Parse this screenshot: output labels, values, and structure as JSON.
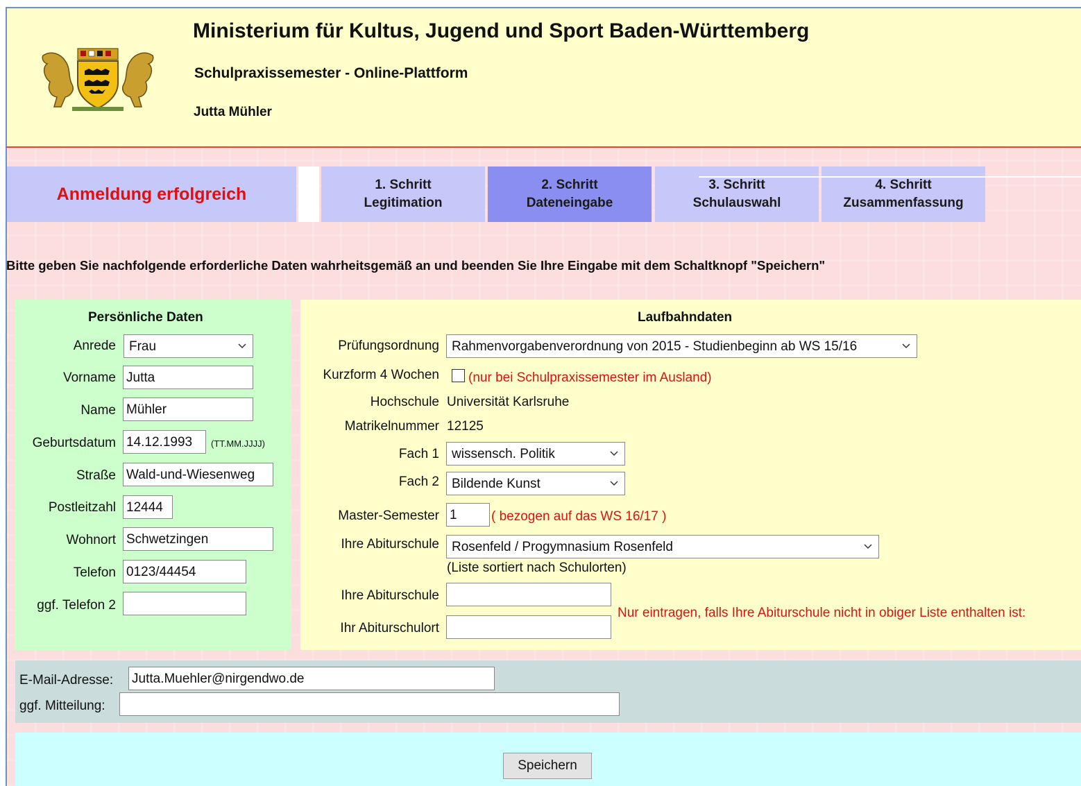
{
  "header": {
    "title": "Ministerium für Kultus, Jugend und Sport Baden-Württemberg",
    "subtitle": "Schulpraxissemester - Online-Plattform",
    "user": "Jutta Mühler"
  },
  "tabs": {
    "status": "Anmeldung erfolgreich",
    "steps": [
      {
        "line1": "1. Schritt",
        "line2": "Legitimation"
      },
      {
        "line1": "2. Schritt",
        "line2": "Dateneingabe"
      },
      {
        "line1": "3. Schritt",
        "line2": "Schulauswahl"
      },
      {
        "line1": "4. Schritt",
        "line2": "Zusammenfassung"
      }
    ],
    "active_step": 2
  },
  "instruction": "Bitte geben Sie nachfolgende erforderliche Daten wahrheitsgemäß an und beenden Sie Ihre Eingabe mit dem Schaltknopf \"Speichern\"",
  "personal": {
    "title": "Persönliche Daten",
    "anrede_label": "Anrede",
    "anrede_value": "Frau",
    "vorname_label": "Vorname",
    "vorname_value": "Jutta",
    "name_label": "Name",
    "name_value": "Mühler",
    "geburtsdatum_label": "Geburtsdatum",
    "geburtsdatum_value": "14.12.1993",
    "geburtsdatum_hint": "(TT.MM.JJJJ)",
    "strasse_label": "Straße",
    "strasse_value": "Wald-und-Wiesenweg",
    "plz_label": "Postleitzahl",
    "plz_value": "12444",
    "wohnort_label": "Wohnort",
    "wohnort_value": "Schwetzingen",
    "telefon_label": "Telefon",
    "telefon_value": "0123/44454",
    "telefon2_label": "ggf. Telefon 2",
    "telefon2_value": ""
  },
  "career": {
    "title": "Laufbahndaten",
    "pruefung_label": "Prüfungsordnung",
    "pruefung_value": "Rahmenvorgabenverordnung von 2015 - Studienbeginn ab WS 15/16",
    "kurzform_label": "Kurzform 4 Wochen",
    "kurzform_note": "(nur bei Schulpraxissemester im Ausland)",
    "hochschule_label": "Hochschule",
    "hochschule_value": "Universität Karlsruhe",
    "matrikel_label": "Matrikelnummer",
    "matrikel_value": "12125",
    "fach1_label": "Fach 1",
    "fach1_value": "wissensch. Politik",
    "fach2_label": "Fach 2",
    "fach2_value": "Bildende Kunst",
    "semester_label": "Master-Semester",
    "semester_value": "1",
    "semester_note": "( bezogen auf das WS 16/17 )",
    "abischule_label": "Ihre Abiturschule",
    "abischule_value": "Rosenfeld / Progymnasium Rosenfeld",
    "abischule_hint": "(Liste sortiert nach Schulorten)",
    "abischule2_label": "Ihre Abiturschule",
    "abischule2_value": "",
    "abiort_label": "Ihr Abiturschulort",
    "abiort_value": "",
    "abi_note": "Nur eintragen, falls Ihre Abiturschule nicht in obiger Liste enthalten ist:"
  },
  "contact": {
    "email_label": "E-Mail-Adresse:",
    "email_value": "Jutta.Muehler@nirgendwo.de",
    "mitteilung_label": "ggf. Mitteilung:",
    "mitteilung_value": ""
  },
  "save_label": "Speichern",
  "colors": {
    "status_red": "#e01010",
    "tab": "#c5c8f8",
    "tab_active": "#8b8ef1",
    "green_panel": "#ccffcc",
    "yellow_panel": "#ffffcc",
    "mail_panel": "#cbdcdc",
    "save_panel": "#ccffff"
  }
}
